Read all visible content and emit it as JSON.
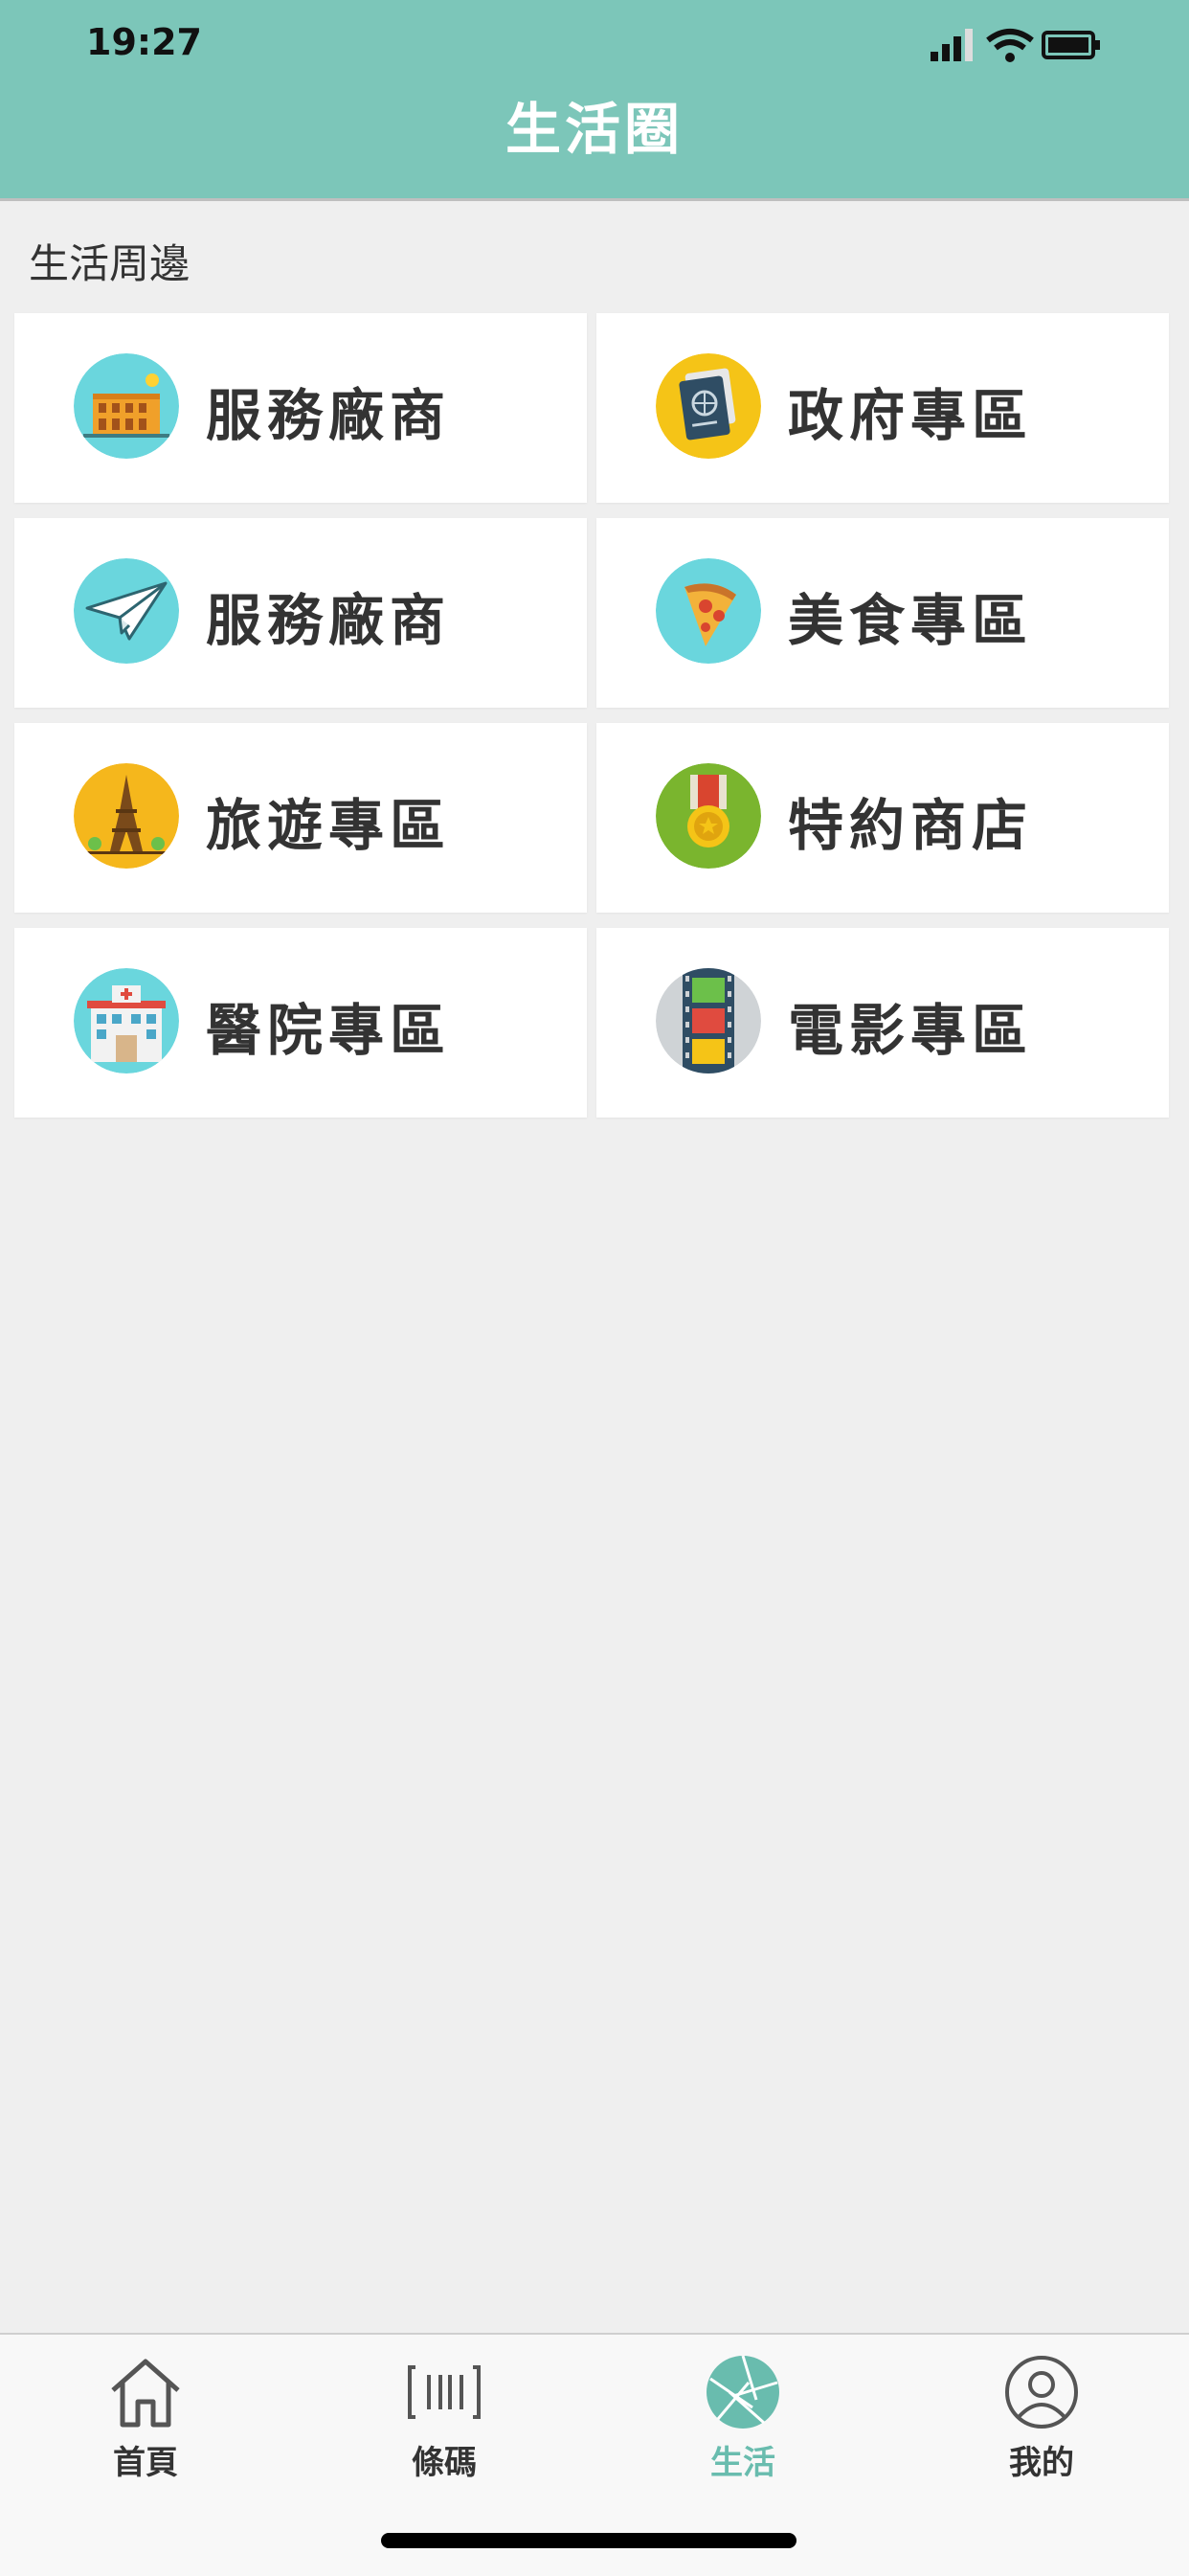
{
  "status": {
    "time": "19:27"
  },
  "header": {
    "title": "生活圈"
  },
  "section": {
    "label": "生活周邊"
  },
  "items": [
    {
      "label": "服務廠商",
      "icon": "colosseum-icon"
    },
    {
      "label": "政府專區",
      "icon": "passport-icon"
    },
    {
      "label": "服務廠商",
      "icon": "paper-plane-icon"
    },
    {
      "label": "美食專區",
      "icon": "pizza-icon"
    },
    {
      "label": "旅遊專區",
      "icon": "eiffel-tower-icon"
    },
    {
      "label": "特約商店",
      "icon": "medal-icon"
    },
    {
      "label": "醫院專區",
      "icon": "hospital-icon"
    },
    {
      "label": "電影專區",
      "icon": "film-strip-icon"
    }
  ],
  "nav": [
    {
      "label": "首頁",
      "icon": "home-icon",
      "active": false
    },
    {
      "label": "條碼",
      "icon": "barcode-icon",
      "active": false
    },
    {
      "label": "生活",
      "icon": "aperture-icon",
      "active": true
    },
    {
      "label": "我的",
      "icon": "user-icon",
      "active": false
    }
  ],
  "colors": {
    "header": "#7cc6b9",
    "active": "#69bcae",
    "background": "#efefef"
  }
}
